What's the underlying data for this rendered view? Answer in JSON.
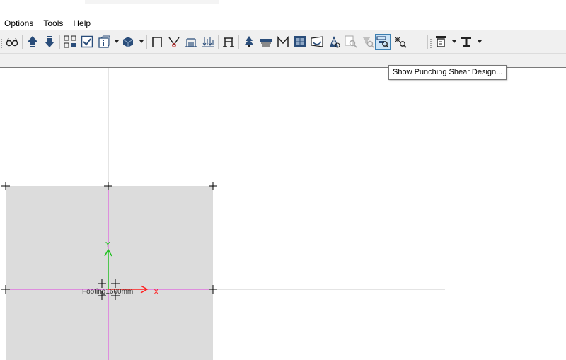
{
  "menu": {
    "items": [
      {
        "label": "Options"
      },
      {
        "label": "Tools"
      },
      {
        "label": "Help"
      }
    ]
  },
  "toolbar": {
    "buttons": [
      {
        "icon": "glasses-icon"
      },
      {
        "icon": "arrow-up-icon"
      },
      {
        "icon": "arrow-down-icon"
      },
      {
        "icon": "select-grid-icon"
      },
      {
        "icon": "checkbox-icon"
      },
      {
        "icon": "info-box-icon"
      },
      {
        "icon": "view-3d-icon"
      },
      {
        "icon": "frame-icon"
      },
      {
        "icon": "bend-icon"
      },
      {
        "icon": "dim-icon"
      },
      {
        "icon": "load-icon"
      },
      {
        "icon": "structure-icon"
      },
      {
        "icon": "tree-icon"
      },
      {
        "icon": "slab-icon"
      },
      {
        "icon": "moment-icon"
      },
      {
        "icon": "grid-view-icon"
      },
      {
        "icon": "deflection-icon"
      },
      {
        "icon": "stress-icon"
      },
      {
        "icon": "zoom-disabled-icon"
      },
      {
        "icon": "filter-disabled-icon"
      },
      {
        "icon": "punching-shear-icon",
        "active": true
      },
      {
        "icon": "detail-icon"
      },
      {
        "icon": "beam-section-icon"
      },
      {
        "icon": "column-section-icon"
      }
    ]
  },
  "tooltip": {
    "text": "Show Punching Shear Design..."
  },
  "drawing": {
    "footing_label": "Footing1600mm",
    "axis_x_label": "X",
    "axis_y_label": "Y",
    "colors": {
      "footing_fill": "#dcdcdc",
      "grid_line": "#c8c8c8",
      "centerline": "#e040e0",
      "axis_x": "#ff2020",
      "axis_y": "#20c020",
      "marker": "#000000"
    }
  }
}
